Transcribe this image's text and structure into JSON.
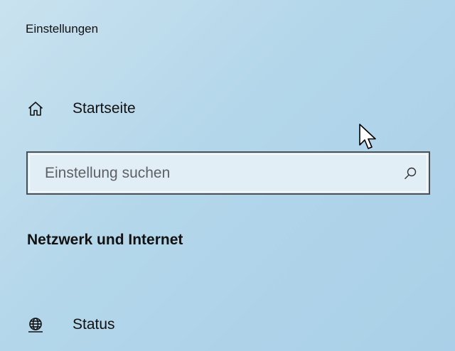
{
  "window": {
    "title": "Einstellungen"
  },
  "nav": {
    "home": {
      "label": "Startseite",
      "icon": "home-icon"
    }
  },
  "search": {
    "value": "",
    "placeholder": "Einstellung suchen",
    "icon": "search-icon"
  },
  "section": {
    "title": "Netzwerk und Internet"
  },
  "items": [
    {
      "label": "Status",
      "icon": "globe-icon"
    }
  ],
  "colors": {
    "background": "#b3d6ea",
    "search_border": "#4a4f55",
    "text": "#111111"
  }
}
